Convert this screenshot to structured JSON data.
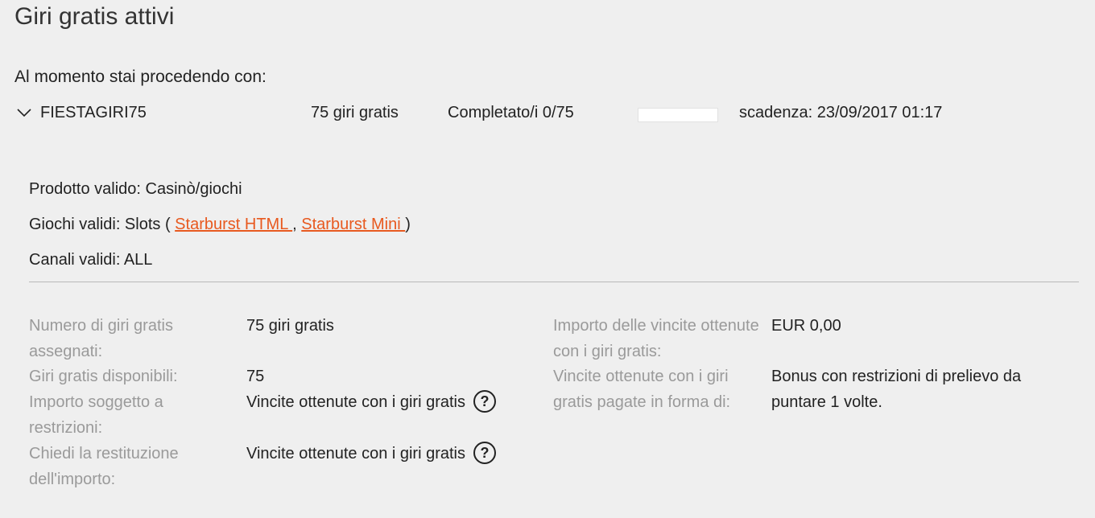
{
  "page": {
    "title": "Giri gratis attivi",
    "intro": "Al momento stai procedendo con:"
  },
  "bonus": {
    "code": "FIESTAGIRI75",
    "spins": "75 giri gratis",
    "progress_text": "Completato/i 0/75",
    "progress_fraction": 0,
    "expiry": "scadenza: 23/09/2017 01:17"
  },
  "details": {
    "product": "Prodotto valido: Casinò/giochi",
    "games_prefix": "Giochi validi: Slots ( ",
    "game1": "Starburst HTML ",
    "games_sep": ", ",
    "game2": "Starburst Mini ",
    "games_suffix": ")",
    "channels": "Canali validi: ALL"
  },
  "info": {
    "assigned_label": "Numero di giri gratis assegnati:",
    "assigned_value": "75 giri gratis",
    "available_label": "Giri gratis disponibili:",
    "available_value": "75",
    "restricted_label": "Importo soggetto a restrizioni:",
    "restricted_value": "Vincite ottenute con i giri gratis",
    "refund_label": "Chiedi la restituzione dell'importo:",
    "refund_value": "Vincite ottenute con i giri gratis",
    "winnings_label": "Importo delle vincite ottenute con i giri gratis:",
    "winnings_value": "EUR 0,00",
    "paid_label": "Vincite ottenute con i giri gratis pagate in forma di:",
    "paid_value": "Bonus con restrizioni di prelievo da puntare 1 volte.",
    "help_glyph": "?"
  },
  "icons": {
    "expand": "chevron-down-icon",
    "help": "question-circle-icon"
  },
  "colors": {
    "link": "#e8591f",
    "label": "#9a9a9a",
    "background": "#efefef"
  }
}
